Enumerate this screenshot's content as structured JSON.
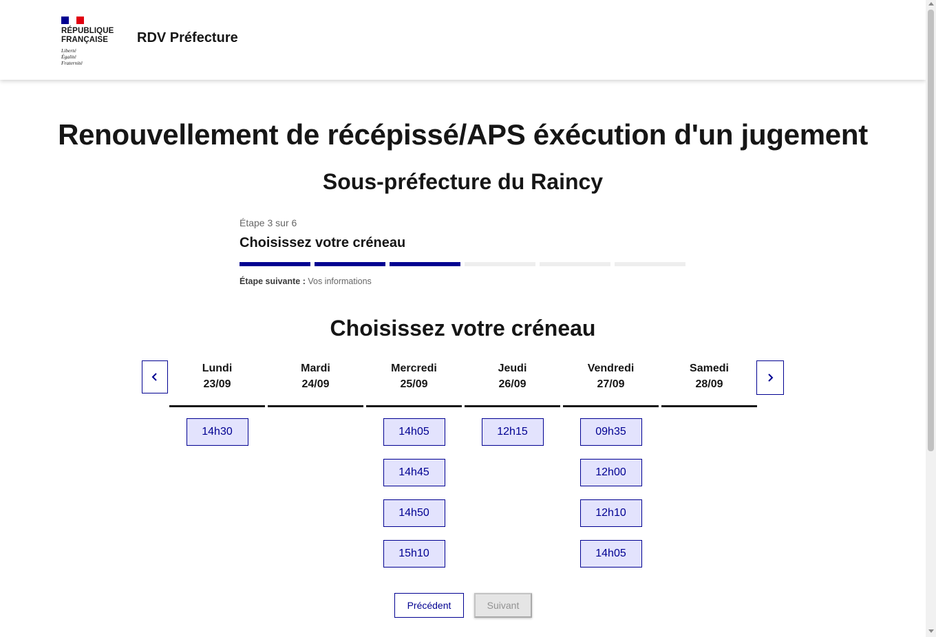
{
  "header": {
    "republic_name": "RÉPUBLIQUE\nFRANÇAISE",
    "motto": "Liberté\nÉgalité\nFraternité",
    "service_title": "RDV Préfecture"
  },
  "main": {
    "title": "Renouvellement de récépissé/APS éxécution d'un jugement",
    "subtitle": "Sous-préfecture du Raincy"
  },
  "stepper": {
    "state": "Étape 3 sur 6",
    "title": "Choisissez votre créneau",
    "current_step": 3,
    "total_steps": 6,
    "next_label": "Étape suivante :",
    "next_value": "Vos informations"
  },
  "calendar": {
    "title": "Choisissez votre créneau",
    "days": [
      {
        "name": "Lundi",
        "date": "23/09",
        "slots": [
          "14h30"
        ]
      },
      {
        "name": "Mardi",
        "date": "24/09",
        "slots": []
      },
      {
        "name": "Mercredi",
        "date": "25/09",
        "slots": [
          "14h05",
          "14h45",
          "14h50",
          "15h10"
        ]
      },
      {
        "name": "Jeudi",
        "date": "26/09",
        "slots": [
          "12h15"
        ]
      },
      {
        "name": "Vendredi",
        "date": "27/09",
        "slots": [
          "09h35",
          "12h00",
          "12h10",
          "14h05"
        ]
      },
      {
        "name": "Samedi",
        "date": "28/09",
        "slots": []
      }
    ],
    "prev_icon": "chevron-left-icon",
    "next_icon": "chevron-right-icon"
  },
  "actions": {
    "previous_label": "Précédent",
    "next_label": "Suivant",
    "next_disabled": true
  },
  "colors": {
    "primary": "#000091",
    "slot_background": "#e3e3fd",
    "flag_red": "#e1000f"
  }
}
